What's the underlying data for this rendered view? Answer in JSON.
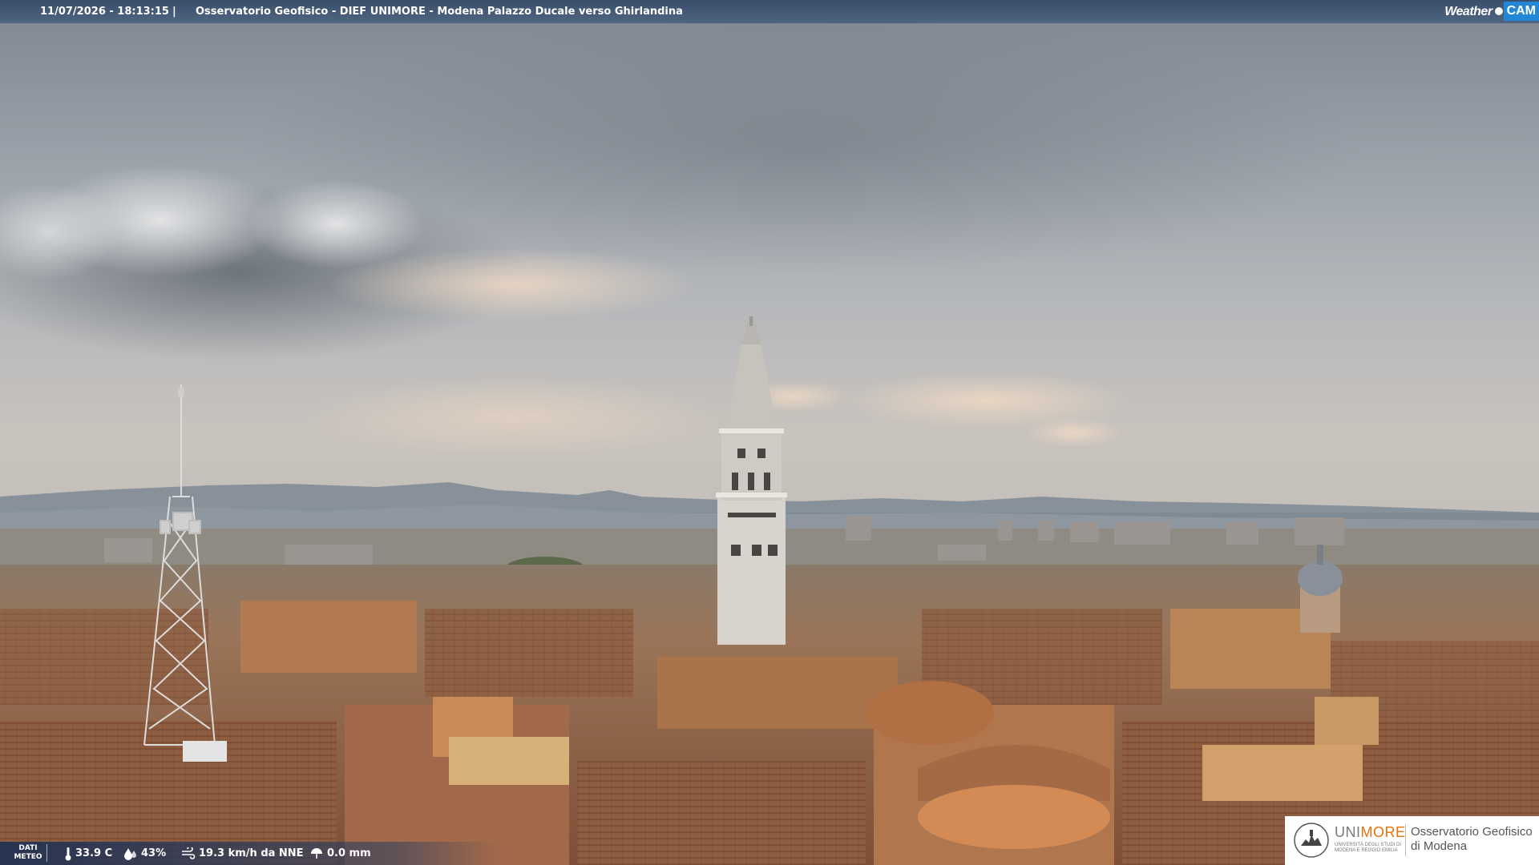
{
  "header": {
    "timestamp": "11/07/2026 - 18:13:15",
    "separator": "|",
    "title": "Osservatorio Geofisico - DIEF UNIMORE - Modena Palazzo Ducale verso Ghirlandina"
  },
  "brand_logo": {
    "weather_text": "Weather",
    "cam_text": "CAM",
    "accent_color": "#2487d6"
  },
  "meteo": {
    "label_line1": "DATI",
    "label_line2": "METEO",
    "temperature": "33.9 C",
    "humidity": "43%",
    "wind": "19.3 km/h da NNE",
    "rain": "0.0 mm",
    "icons": [
      "thermometer-icon",
      "humidity-drop-icon",
      "wind-icon",
      "rain-icon"
    ]
  },
  "footer_logo": {
    "name_prefix": "UNI",
    "name_highlight": "MORE",
    "name_highlight_color": "#e8720c",
    "subtitle": "UNIVERSITÀ DEGLI STUDI DI MODENA E REGGIO EMILIA",
    "observatory_line1": "Osservatorio Geofisico",
    "observatory_line2": "di Modena"
  }
}
